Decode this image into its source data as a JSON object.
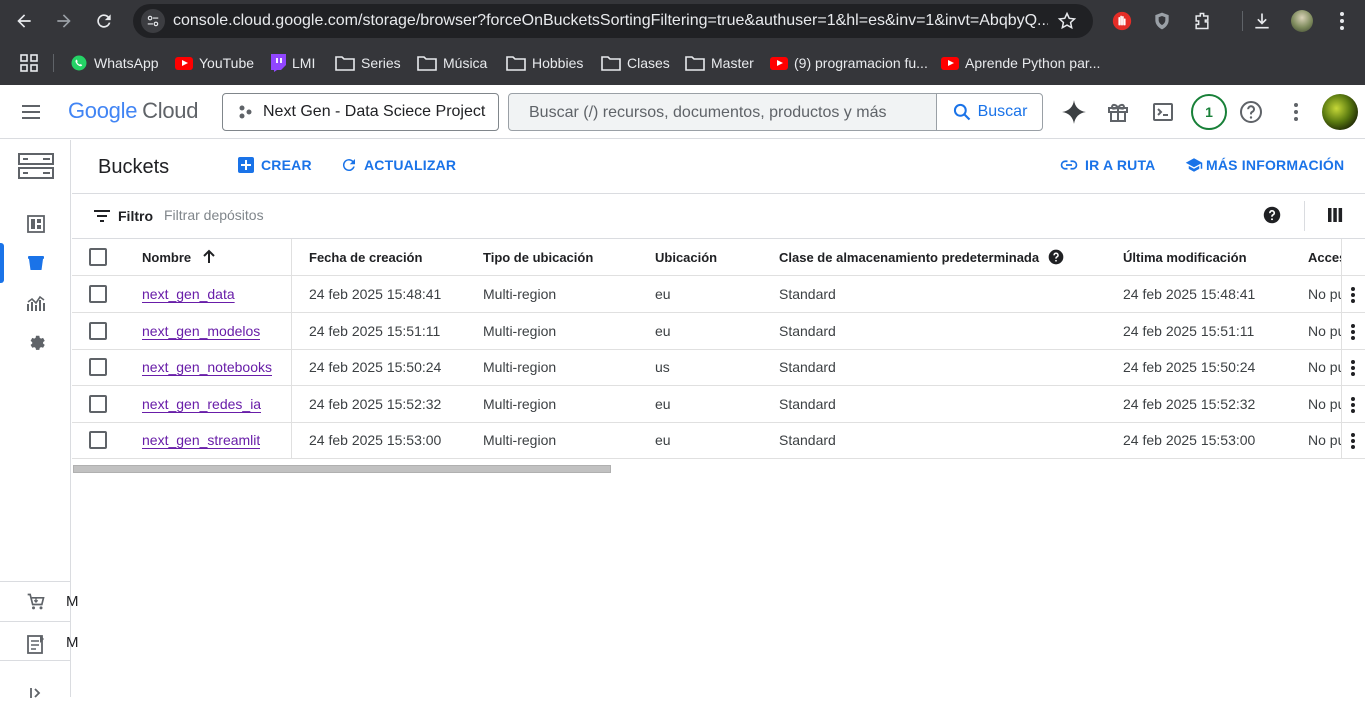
{
  "browser": {
    "url": "console.cloud.google.com/storage/browser?forceOnBucketsSortingFiltering=true&authuser=1&hl=es&inv=1&invt=AbqbyQ...",
    "bookmarks": [
      "WhatsApp",
      "YouTube",
      "LMI",
      "Series",
      "Música",
      "Hobbies",
      "Clases",
      "Master",
      "(9) programacion fu...",
      "Aprende Python par..."
    ]
  },
  "header": {
    "logo_google": "Google",
    "logo_cloud": "Cloud",
    "project": "Next Gen - Data Sciece Project",
    "search_placeholder": "Buscar (/) recursos, documentos, productos y más",
    "search_button": "Buscar",
    "notification_count": "1"
  },
  "page": {
    "title": "Buckets",
    "create": "CREAR",
    "refresh": "ACTUALIZAR",
    "goto_path": "IR A RUTA",
    "more_info": "MÁS INFORMACIÓN"
  },
  "filter": {
    "label": "Filtro",
    "placeholder": "Filtrar depósitos"
  },
  "table": {
    "columns": [
      "Nombre",
      "Fecha de creación",
      "Tipo de ubicación",
      "Ubicación",
      "Clase de almacenamiento predeterminada",
      "Última modificación",
      "Acces"
    ],
    "rows": [
      [
        "next_gen_data",
        "24 feb 2025 15:48:41",
        "Multi-region",
        "eu",
        "Standard",
        "24 feb 2025 15:48:41",
        "No pu"
      ],
      [
        "next_gen_modelos",
        "24 feb 2025 15:51:11",
        "Multi-region",
        "eu",
        "Standard",
        "24 feb 2025 15:51:11",
        "No pu"
      ],
      [
        "next_gen_notebooks",
        "24 feb 2025 15:50:24",
        "Multi-region",
        "us",
        "Standard",
        "24 feb 2025 15:50:24",
        "No pu"
      ],
      [
        "next_gen_redes_ia",
        "24 feb 2025 15:52:32",
        "Multi-region",
        "eu",
        "Standard",
        "24 feb 2025 15:52:32",
        "No pu"
      ],
      [
        "next_gen_streamlit",
        "24 feb 2025 15:53:00",
        "Multi-region",
        "eu",
        "Standard",
        "24 feb 2025 15:53:00",
        "No pu"
      ]
    ]
  },
  "rail": {
    "peek_1": "M",
    "peek_2": "M"
  },
  "colors": {
    "accent": "#1a73e8",
    "link_visited": "#681da8",
    "chrome_dark": "#35363a"
  }
}
